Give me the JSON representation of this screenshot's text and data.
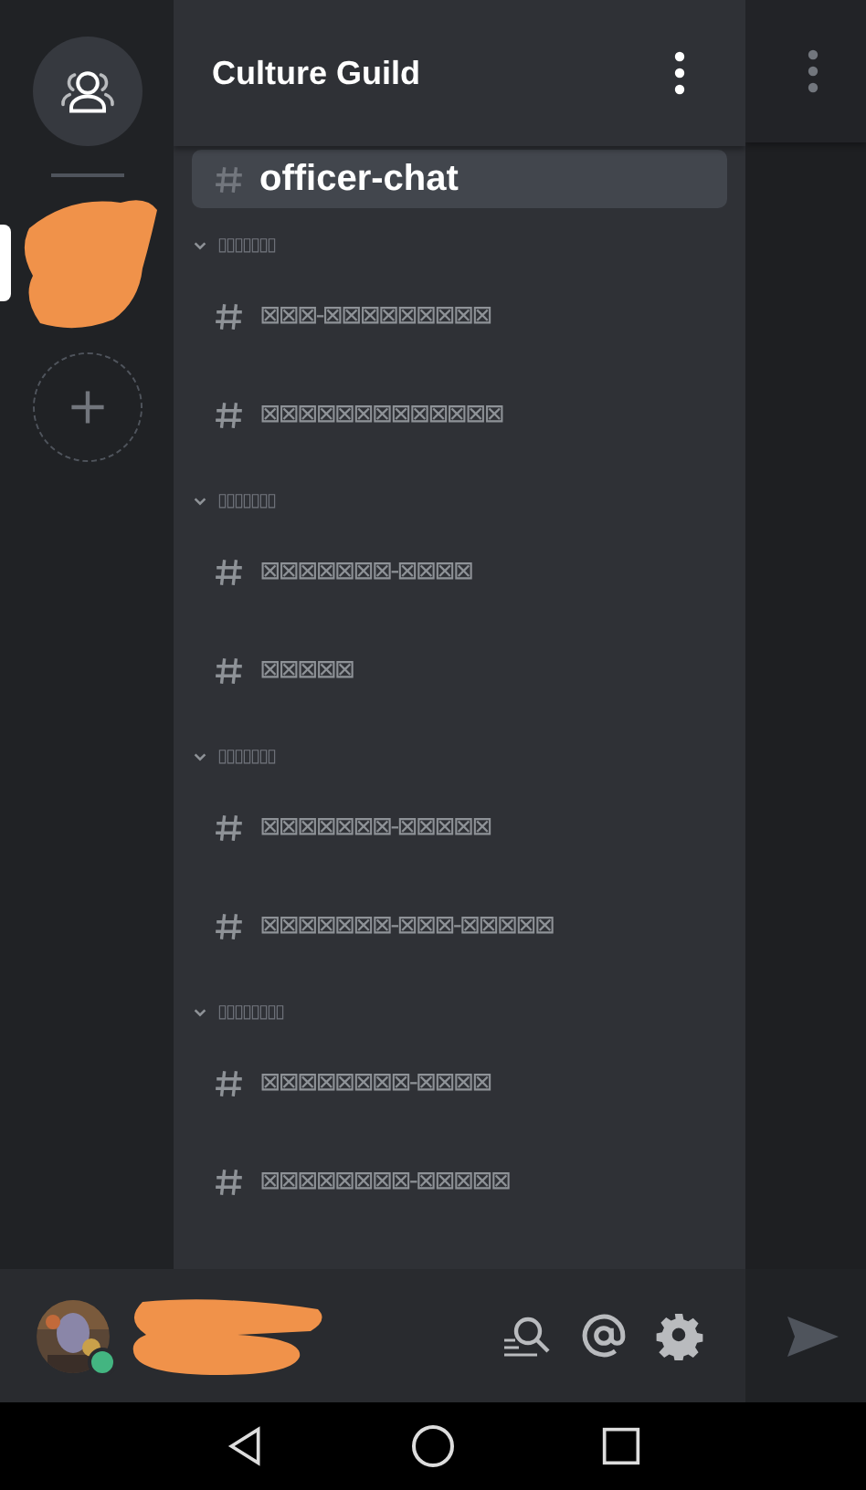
{
  "server": {
    "name": "Culture Guild"
  },
  "channels": [
    {
      "name": "officer-chat",
      "selected": true
    }
  ],
  "categories": [
    {
      "name": "▯▯▯▯▯▯▯",
      "expanded": true,
      "channels": [
        {
          "name": "⊠⊠⊠-⊠⊠⊠⊠⊠⊠⊠⊠⊠",
          "selected": false
        },
        {
          "name": "⊠⊠⊠⊠⊠⊠⊠⊠⊠⊠⊠⊠⊠",
          "selected": false
        }
      ]
    },
    {
      "name": "▯▯▯▯▯▯▯",
      "expanded": true,
      "channels": [
        {
          "name": "⊠⊠⊠⊠⊠⊠⊠-⊠⊠⊠⊠",
          "selected": false
        },
        {
          "name": "⊠⊠⊠⊠⊠",
          "selected": false
        }
      ]
    },
    {
      "name": "▯▯▯▯▯▯▯",
      "expanded": true,
      "channels": [
        {
          "name": "⊠⊠⊠⊠⊠⊠⊠-⊠⊠⊠⊠⊠",
          "selected": false
        },
        {
          "name": "⊠⊠⊠⊠⊠⊠⊠-⊠⊠⊠-⊠⊠⊠⊠⊠",
          "selected": false
        }
      ]
    },
    {
      "name": "▯▯▯▯▯▯▯▯",
      "expanded": true,
      "channels": [
        {
          "name": "⊠⊠⊠⊠⊠⊠⊠⊠-⊠⊠⊠⊠",
          "selected": false
        },
        {
          "name": "⊠⊠⊠⊠⊠⊠⊠⊠-⊠⊠⊠⊠⊠",
          "selected": false
        }
      ]
    }
  ],
  "user": {
    "online": true
  }
}
